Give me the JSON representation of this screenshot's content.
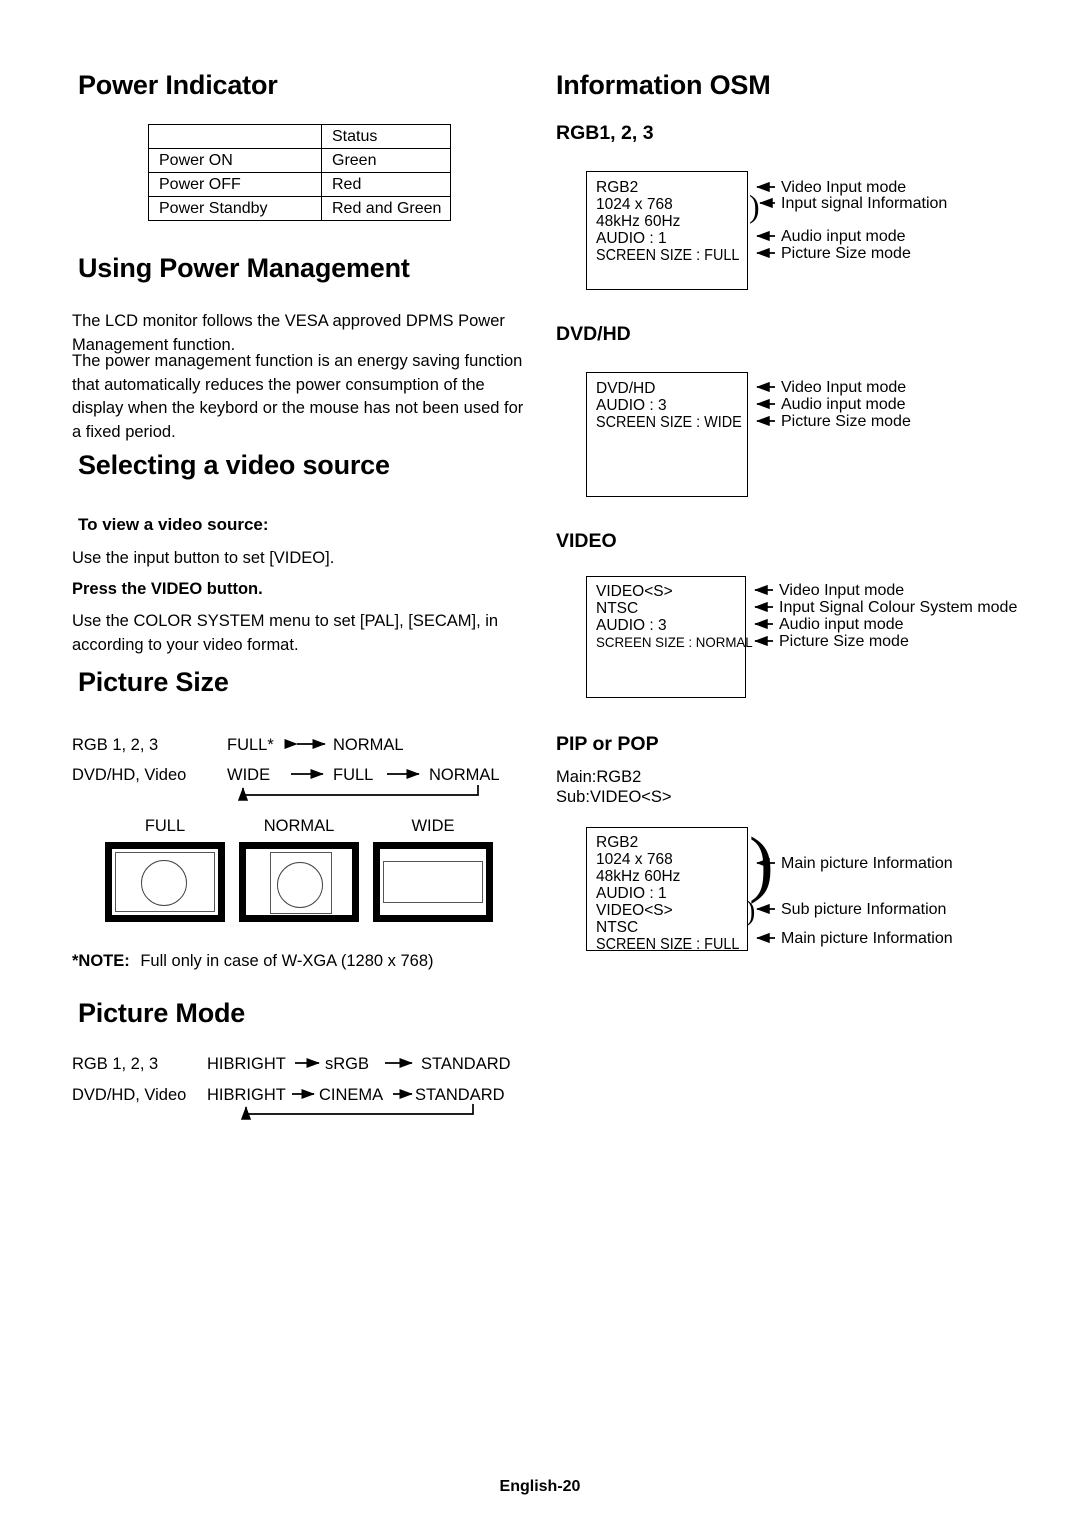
{
  "page": {
    "footer": "English-20"
  },
  "left_column": {
    "power_indicator": {
      "heading": "Power Indicator",
      "table": {
        "header": [
          "",
          "Status"
        ],
        "rows": [
          [
            "Power ON",
            "Green"
          ],
          [
            "Power OFF",
            "Red"
          ],
          [
            "Power Standby",
            "Red and Green"
          ]
        ]
      }
    },
    "power_management": {
      "heading": "Using Power Management",
      "paragraph1": "The LCD monitor follows the VESA approved DPMS Power Management function.",
      "paragraph2": "The power management function is an energy saving function that automatically reduces the power consumption of the display when the keybord or the mouse has not been used for a fixed period."
    },
    "video_source": {
      "heading": "Selecting a video source",
      "subheading": "To view a video source:",
      "line1": "Use the input button to set [VIDEO].",
      "line2_bold": "Press the VIDEO button.",
      "line3": "Use the COLOR SYSTEM menu to set [PAL], [SECAM], in according to your video format."
    },
    "picture_size": {
      "heading": "Picture Size",
      "rows": [
        {
          "label": "RGB 1, 2, 3",
          "items": [
            "FULL*",
            "NORMAL"
          ],
          "arrow": "bidirectional"
        },
        {
          "label": "DVD/HD, Video",
          "items": [
            "WIDE",
            "FULL",
            "NORMAL"
          ],
          "arrow": "cycle"
        }
      ],
      "diagrams": [
        {
          "caption": "FULL",
          "kind": "full"
        },
        {
          "caption": "NORMAL",
          "kind": "normal"
        },
        {
          "caption": "WIDE",
          "kind": "wide"
        }
      ],
      "note_label": "*NOTE:",
      "note_text": "Full only in case of W-XGA (1280 x 768)"
    },
    "picture_mode": {
      "heading": "Picture Mode",
      "rows": [
        {
          "label": "RGB 1, 2, 3",
          "items": [
            "HIBRIGHT",
            "sRGB",
            "STANDARD"
          ]
        },
        {
          "label": "DVD/HD, Video",
          "items": [
            "HIBRIGHT",
            "CINEMA",
            "STANDARD"
          ]
        }
      ]
    }
  },
  "right_column": {
    "information_osm": {
      "heading": "Information OSM",
      "sections": [
        {
          "title": "RGB1, 2, 3",
          "osm_lines": [
            "RGB2",
            "1024 x 768",
            "48kHz  60Hz",
            "AUDIO : 1",
            "SCREEN SIZE : FULL"
          ],
          "callouts": [
            "Video Input mode",
            "Input signal Information",
            "Audio input mode",
            "Picture Size mode"
          ]
        },
        {
          "title": "DVD/HD",
          "osm_lines": [
            "DVD/HD",
            "AUDIO : 3",
            "SCREEN SIZE : WIDE"
          ],
          "callouts": [
            "Video Input mode",
            "Audio input mode",
            "Picture Size mode"
          ]
        },
        {
          "title": "VIDEO",
          "osm_lines": [
            "VIDEO<S>",
            "NTSC",
            "AUDIO : 3",
            "SCREEN SIZE : NORMAL"
          ],
          "callouts": [
            "Video Input mode",
            "Input Signal Colour System mode",
            "Audio input mode",
            "Picture Size mode"
          ]
        },
        {
          "title": "PIP or POP",
          "pre_lines": [
            "Main:RGB2",
            "Sub:VIDEO<S>"
          ],
          "osm_lines": [
            "RGB2",
            "1024 x 768",
            "48kHz  60Hz",
            "AUDIO : 1",
            "VIDEO<S>",
            "NTSC",
            "SCREEN SIZE : FULL"
          ],
          "callouts": [
            "Main picture Information",
            "Sub picture Information",
            "Main picture Information"
          ]
        }
      ]
    }
  }
}
